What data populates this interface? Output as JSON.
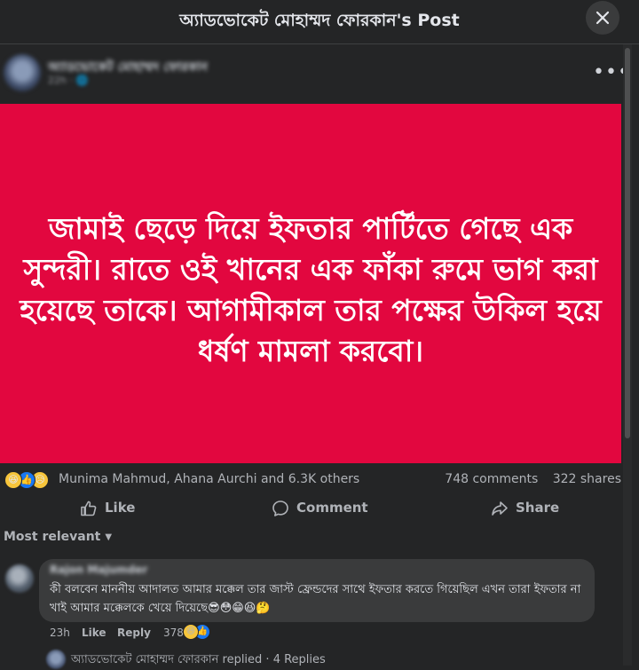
{
  "header": {
    "title": "অ্যাডভোকেট মোহাম্মদ ফোরকান's Post",
    "close_icon": "close-icon"
  },
  "author": {
    "name": "অ্যাডভোকেট মোহাম্মদ ফোরকান",
    "time": "22h · 🌐",
    "more_label": "•••"
  },
  "post": {
    "text": "জামাই ছেড়ে দিয়ে ইফতার পার্টিতে গেছে এক সুন্দরী। রাতে ওই খানের এক ফাঁকা রুমে ভাগ করা হয়েছে তাকে। আগামীকাল তার পক্ষের উকিল হয়ে ধর্ষণ মামলা করবো।",
    "background_color": "#e2073f"
  },
  "reactions": {
    "icons": [
      "haha",
      "like",
      "sad"
    ],
    "haha_glyph": "😆",
    "like_glyph": "👍",
    "sad_glyph": "😥",
    "summary": "Munima Mahmud, Ahana Aurchi and 6.3K others",
    "comments": "748 comments",
    "shares": "322 shares"
  },
  "actions": {
    "like": "Like",
    "comment": "Comment",
    "share": "Share"
  },
  "sort": {
    "label": "Most relevant"
  },
  "comment": {
    "author": "Rajon Majumder",
    "text": "কী বলবেন মাননীয় আদালত আমার মক্কেল তার জাস্ট ফ্রেন্ডদের সাথে ইফতার করতে গিয়েছিল এখন তারা ইফতার না খাই আমার মক্কেলকে খেয়ে দিয়েছে😎😳😁😆🤔",
    "time": "23h",
    "like": "Like",
    "reply": "Reply",
    "reaction_count": "378",
    "react1": "😆",
    "react2": "👍"
  },
  "reply_preview": {
    "text": "অ্যাডভোকেট মোহাম্মদ ফোরকান replied · 4 Replies"
  }
}
